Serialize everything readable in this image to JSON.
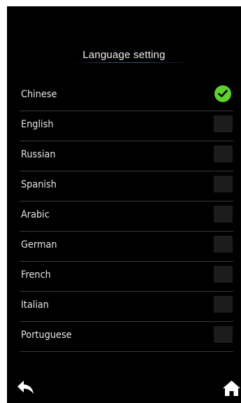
{
  "header": {
    "title": "Language setting"
  },
  "languages": [
    {
      "label": "Chinese",
      "selected": true
    },
    {
      "label": "English",
      "selected": false
    },
    {
      "label": "Russian",
      "selected": false
    },
    {
      "label": "Spanish",
      "selected": false
    },
    {
      "label": "Arabic",
      "selected": false
    },
    {
      "label": "German",
      "selected": false
    },
    {
      "label": "French",
      "selected": false
    },
    {
      "label": "Italian",
      "selected": false
    },
    {
      "label": "Portuguese",
      "selected": false
    }
  ],
  "icons": {
    "selected": "check-icon",
    "back": "back-arrow-icon",
    "home": "home-icon"
  },
  "colors": {
    "background": "#000000",
    "text": "#e6e6e6",
    "check_accent": "#5fd12e",
    "divider": "#3a3a3a",
    "unchecked_box": "#1c1c1c"
  }
}
